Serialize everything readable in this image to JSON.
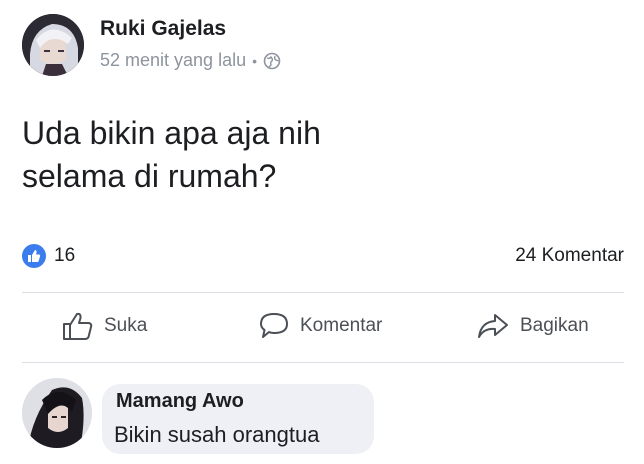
{
  "post": {
    "author": "Ruki Gajelas",
    "time": "52 menit yang lalu",
    "separator": "•",
    "privacy_icon": "globe-icon",
    "text_lines": [
      "Uda bikin apa aja nih",
      "selama di rumah?"
    ]
  },
  "stats": {
    "reaction_icon": "like-icon",
    "reaction_color": "#3b7ded",
    "likes": "16",
    "comments": "24 Komentar"
  },
  "actions": {
    "like": "Suka",
    "comment": "Komentar",
    "share": "Bagikan"
  },
  "comment": {
    "author": "Mamang Awo",
    "text": "Bikin susah orangtua"
  }
}
